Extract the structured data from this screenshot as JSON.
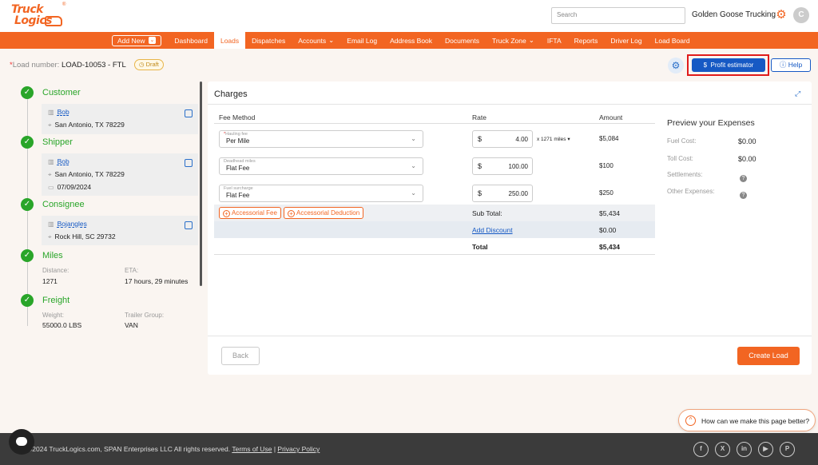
{
  "header": {
    "logo_line1": "Truck",
    "logo_line2": "Logics",
    "logo_reg": "®",
    "search_placeholder": "Search",
    "company": "Golden Goose Trucking",
    "avatar_initial": "C"
  },
  "nav": {
    "add_new": "Add New",
    "items": [
      "Dashboard",
      "Loads",
      "Dispatches",
      "Accounts",
      "Email Log",
      "Address Book",
      "Documents",
      "Truck Zone",
      "IFTA",
      "Reports",
      "Driver Log",
      "Load Board"
    ],
    "active": "Loads"
  },
  "load": {
    "star": "*",
    "label": "Load number:",
    "number": "LOAD-10053 - FTL",
    "status": "Draft",
    "profit_button": "Profit estimator",
    "profit_icon": "$",
    "help_button": "Help"
  },
  "steps": {
    "customer": {
      "title": "Customer",
      "name": "Bob",
      "address": "San Antonio, TX 78229"
    },
    "shipper": {
      "title": "Shipper",
      "name": "Bob",
      "address": "San Antonio, TX 78229",
      "date": "07/09/2024"
    },
    "consignee": {
      "title": "Consignee",
      "name": "Bojangles",
      "address": "Rock Hill, SC 29732"
    },
    "miles": {
      "title": "Miles",
      "distance_label": "Distance:",
      "distance": "1271",
      "eta_label": "ETA:",
      "eta": "17 hours, 29 minutes"
    },
    "freight": {
      "title": "Freight",
      "weight_label": "Weight:",
      "weight": "55000.0 LBS",
      "trailer_label": "Trailer Group:",
      "trailer": "VAN"
    }
  },
  "charges": {
    "title": "Charges",
    "col_fee": "Fee Method",
    "col_rate": "Rate",
    "col_amount": "Amount",
    "rows": [
      {
        "label_star": "*",
        "label": "Hauling fee",
        "method": "Per Mile",
        "currency": "$",
        "rate": "4.00",
        "miles": "x 1271 miles",
        "amount": "$5,084"
      },
      {
        "label_star": "",
        "label": "Deadhead miles",
        "method": "Flat Fee",
        "currency": "$",
        "rate": "100.00",
        "miles": "",
        "amount": "$100"
      },
      {
        "label_star": "",
        "label": "Fuel surcharge",
        "method": "Flat Fee",
        "currency": "$",
        "rate": "250.00",
        "miles": "",
        "amount": "$250"
      }
    ],
    "accessorial_fee": "Accessorial Fee",
    "accessorial_deduction": "Accessorial Deduction",
    "subtotal_label": "Sub Total:",
    "subtotal": "$5,434",
    "discount_label": "Add Discount",
    "discount": "$0.00",
    "total_label": "Total",
    "total": "$5,434"
  },
  "preview": {
    "title": "Preview your Expenses",
    "fuel_label": "Fuel Cost:",
    "fuel": "$0.00",
    "toll_label": "Toll Cost:",
    "toll": "$0.00",
    "settlements_label": "Settlements:",
    "other_label": "Other Expenses:"
  },
  "actions": {
    "back": "Back",
    "create": "Create Load"
  },
  "feedback": {
    "text": "How can we make this page better?"
  },
  "footer": {
    "copyright": "©2024 TruckLogics.com, SPAN Enterprises LLC All rights reserved.",
    "terms": "Terms of Use",
    "sep": "|",
    "privacy": "Privacy Policy",
    "social_icons": [
      "facebook-icon",
      "x-icon",
      "linkedin-icon",
      "youtube-icon",
      "pinterest-icon"
    ]
  },
  "colors": {
    "brand": "#f26522",
    "primary": "#1659c4",
    "success": "#29a529",
    "highlight": "#e01b1b"
  }
}
